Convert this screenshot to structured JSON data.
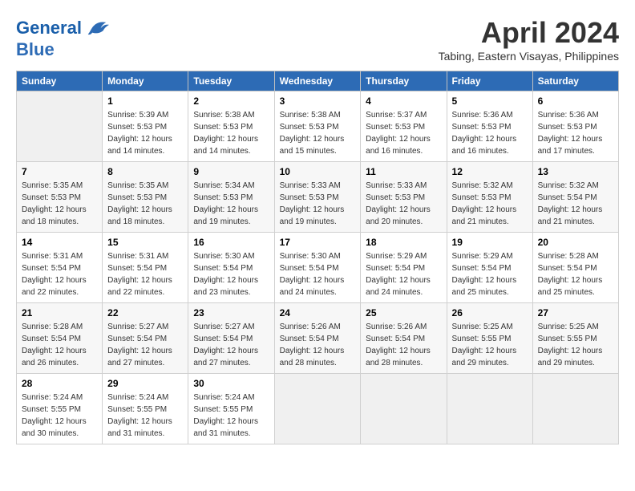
{
  "header": {
    "logo_line1": "General",
    "logo_line2": "Blue",
    "month": "April 2024",
    "location": "Tabing, Eastern Visayas, Philippines"
  },
  "columns": [
    "Sunday",
    "Monday",
    "Tuesday",
    "Wednesday",
    "Thursday",
    "Friday",
    "Saturday"
  ],
  "weeks": [
    [
      {
        "day": "",
        "info": ""
      },
      {
        "day": "1",
        "info": "Sunrise: 5:39 AM\nSunset: 5:53 PM\nDaylight: 12 hours\nand 14 minutes."
      },
      {
        "day": "2",
        "info": "Sunrise: 5:38 AM\nSunset: 5:53 PM\nDaylight: 12 hours\nand 14 minutes."
      },
      {
        "day": "3",
        "info": "Sunrise: 5:38 AM\nSunset: 5:53 PM\nDaylight: 12 hours\nand 15 minutes."
      },
      {
        "day": "4",
        "info": "Sunrise: 5:37 AM\nSunset: 5:53 PM\nDaylight: 12 hours\nand 16 minutes."
      },
      {
        "day": "5",
        "info": "Sunrise: 5:36 AM\nSunset: 5:53 PM\nDaylight: 12 hours\nand 16 minutes."
      },
      {
        "day": "6",
        "info": "Sunrise: 5:36 AM\nSunset: 5:53 PM\nDaylight: 12 hours\nand 17 minutes."
      }
    ],
    [
      {
        "day": "7",
        "info": "Sunrise: 5:35 AM\nSunset: 5:53 PM\nDaylight: 12 hours\nand 18 minutes."
      },
      {
        "day": "8",
        "info": "Sunrise: 5:35 AM\nSunset: 5:53 PM\nDaylight: 12 hours\nand 18 minutes."
      },
      {
        "day": "9",
        "info": "Sunrise: 5:34 AM\nSunset: 5:53 PM\nDaylight: 12 hours\nand 19 minutes."
      },
      {
        "day": "10",
        "info": "Sunrise: 5:33 AM\nSunset: 5:53 PM\nDaylight: 12 hours\nand 19 minutes."
      },
      {
        "day": "11",
        "info": "Sunrise: 5:33 AM\nSunset: 5:53 PM\nDaylight: 12 hours\nand 20 minutes."
      },
      {
        "day": "12",
        "info": "Sunrise: 5:32 AM\nSunset: 5:53 PM\nDaylight: 12 hours\nand 21 minutes."
      },
      {
        "day": "13",
        "info": "Sunrise: 5:32 AM\nSunset: 5:54 PM\nDaylight: 12 hours\nand 21 minutes."
      }
    ],
    [
      {
        "day": "14",
        "info": "Sunrise: 5:31 AM\nSunset: 5:54 PM\nDaylight: 12 hours\nand 22 minutes."
      },
      {
        "day": "15",
        "info": "Sunrise: 5:31 AM\nSunset: 5:54 PM\nDaylight: 12 hours\nand 22 minutes."
      },
      {
        "day": "16",
        "info": "Sunrise: 5:30 AM\nSunset: 5:54 PM\nDaylight: 12 hours\nand 23 minutes."
      },
      {
        "day": "17",
        "info": "Sunrise: 5:30 AM\nSunset: 5:54 PM\nDaylight: 12 hours\nand 24 minutes."
      },
      {
        "day": "18",
        "info": "Sunrise: 5:29 AM\nSunset: 5:54 PM\nDaylight: 12 hours\nand 24 minutes."
      },
      {
        "day": "19",
        "info": "Sunrise: 5:29 AM\nSunset: 5:54 PM\nDaylight: 12 hours\nand 25 minutes."
      },
      {
        "day": "20",
        "info": "Sunrise: 5:28 AM\nSunset: 5:54 PM\nDaylight: 12 hours\nand 25 minutes."
      }
    ],
    [
      {
        "day": "21",
        "info": "Sunrise: 5:28 AM\nSunset: 5:54 PM\nDaylight: 12 hours\nand 26 minutes."
      },
      {
        "day": "22",
        "info": "Sunrise: 5:27 AM\nSunset: 5:54 PM\nDaylight: 12 hours\nand 27 minutes."
      },
      {
        "day": "23",
        "info": "Sunrise: 5:27 AM\nSunset: 5:54 PM\nDaylight: 12 hours\nand 27 minutes."
      },
      {
        "day": "24",
        "info": "Sunrise: 5:26 AM\nSunset: 5:54 PM\nDaylight: 12 hours\nand 28 minutes."
      },
      {
        "day": "25",
        "info": "Sunrise: 5:26 AM\nSunset: 5:54 PM\nDaylight: 12 hours\nand 28 minutes."
      },
      {
        "day": "26",
        "info": "Sunrise: 5:25 AM\nSunset: 5:55 PM\nDaylight: 12 hours\nand 29 minutes."
      },
      {
        "day": "27",
        "info": "Sunrise: 5:25 AM\nSunset: 5:55 PM\nDaylight: 12 hours\nand 29 minutes."
      }
    ],
    [
      {
        "day": "28",
        "info": "Sunrise: 5:24 AM\nSunset: 5:55 PM\nDaylight: 12 hours\nand 30 minutes."
      },
      {
        "day": "29",
        "info": "Sunrise: 5:24 AM\nSunset: 5:55 PM\nDaylight: 12 hours\nand 31 minutes."
      },
      {
        "day": "30",
        "info": "Sunrise: 5:24 AM\nSunset: 5:55 PM\nDaylight: 12 hours\nand 31 minutes."
      },
      {
        "day": "",
        "info": ""
      },
      {
        "day": "",
        "info": ""
      },
      {
        "day": "",
        "info": ""
      },
      {
        "day": "",
        "info": ""
      }
    ]
  ]
}
